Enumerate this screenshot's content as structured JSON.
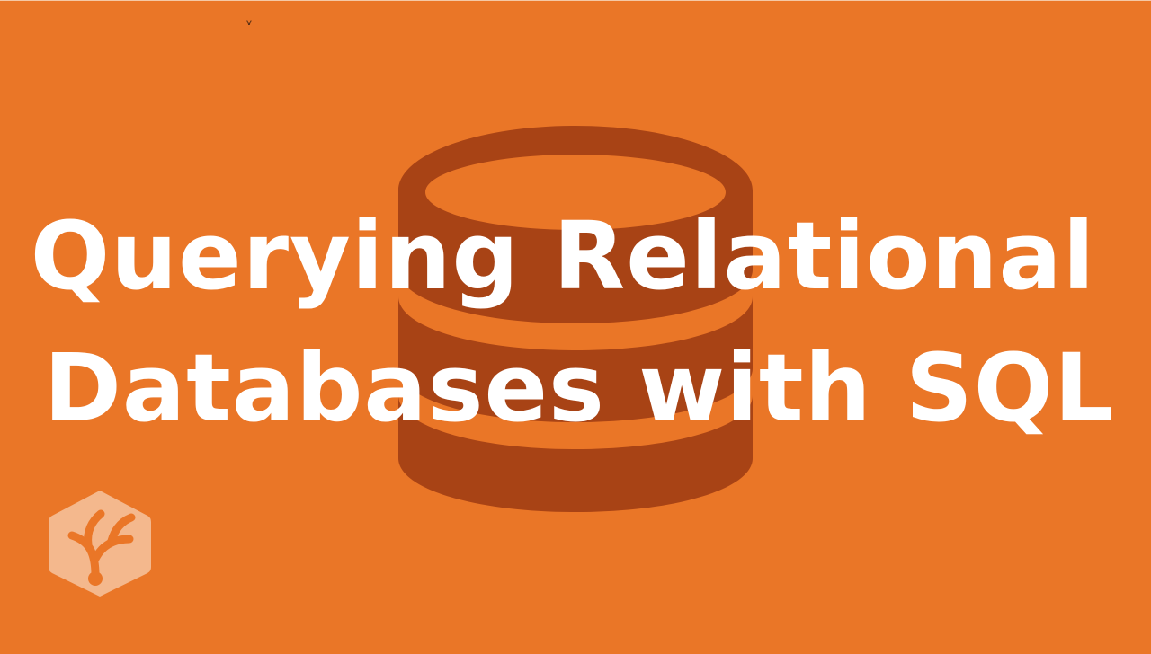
{
  "page": {
    "background_color": "#ea7627",
    "icon_color": "#a84315",
    "text_color": "#ffffff",
    "logo_color": "#f4b88d"
  },
  "marker": {
    "text": "v"
  },
  "title": {
    "line1": "Querying Relational",
    "line2": "Databases with SQL"
  },
  "icons": {
    "background_icon": "database-icon",
    "brand_logo": "treehouse-logo-icon"
  }
}
